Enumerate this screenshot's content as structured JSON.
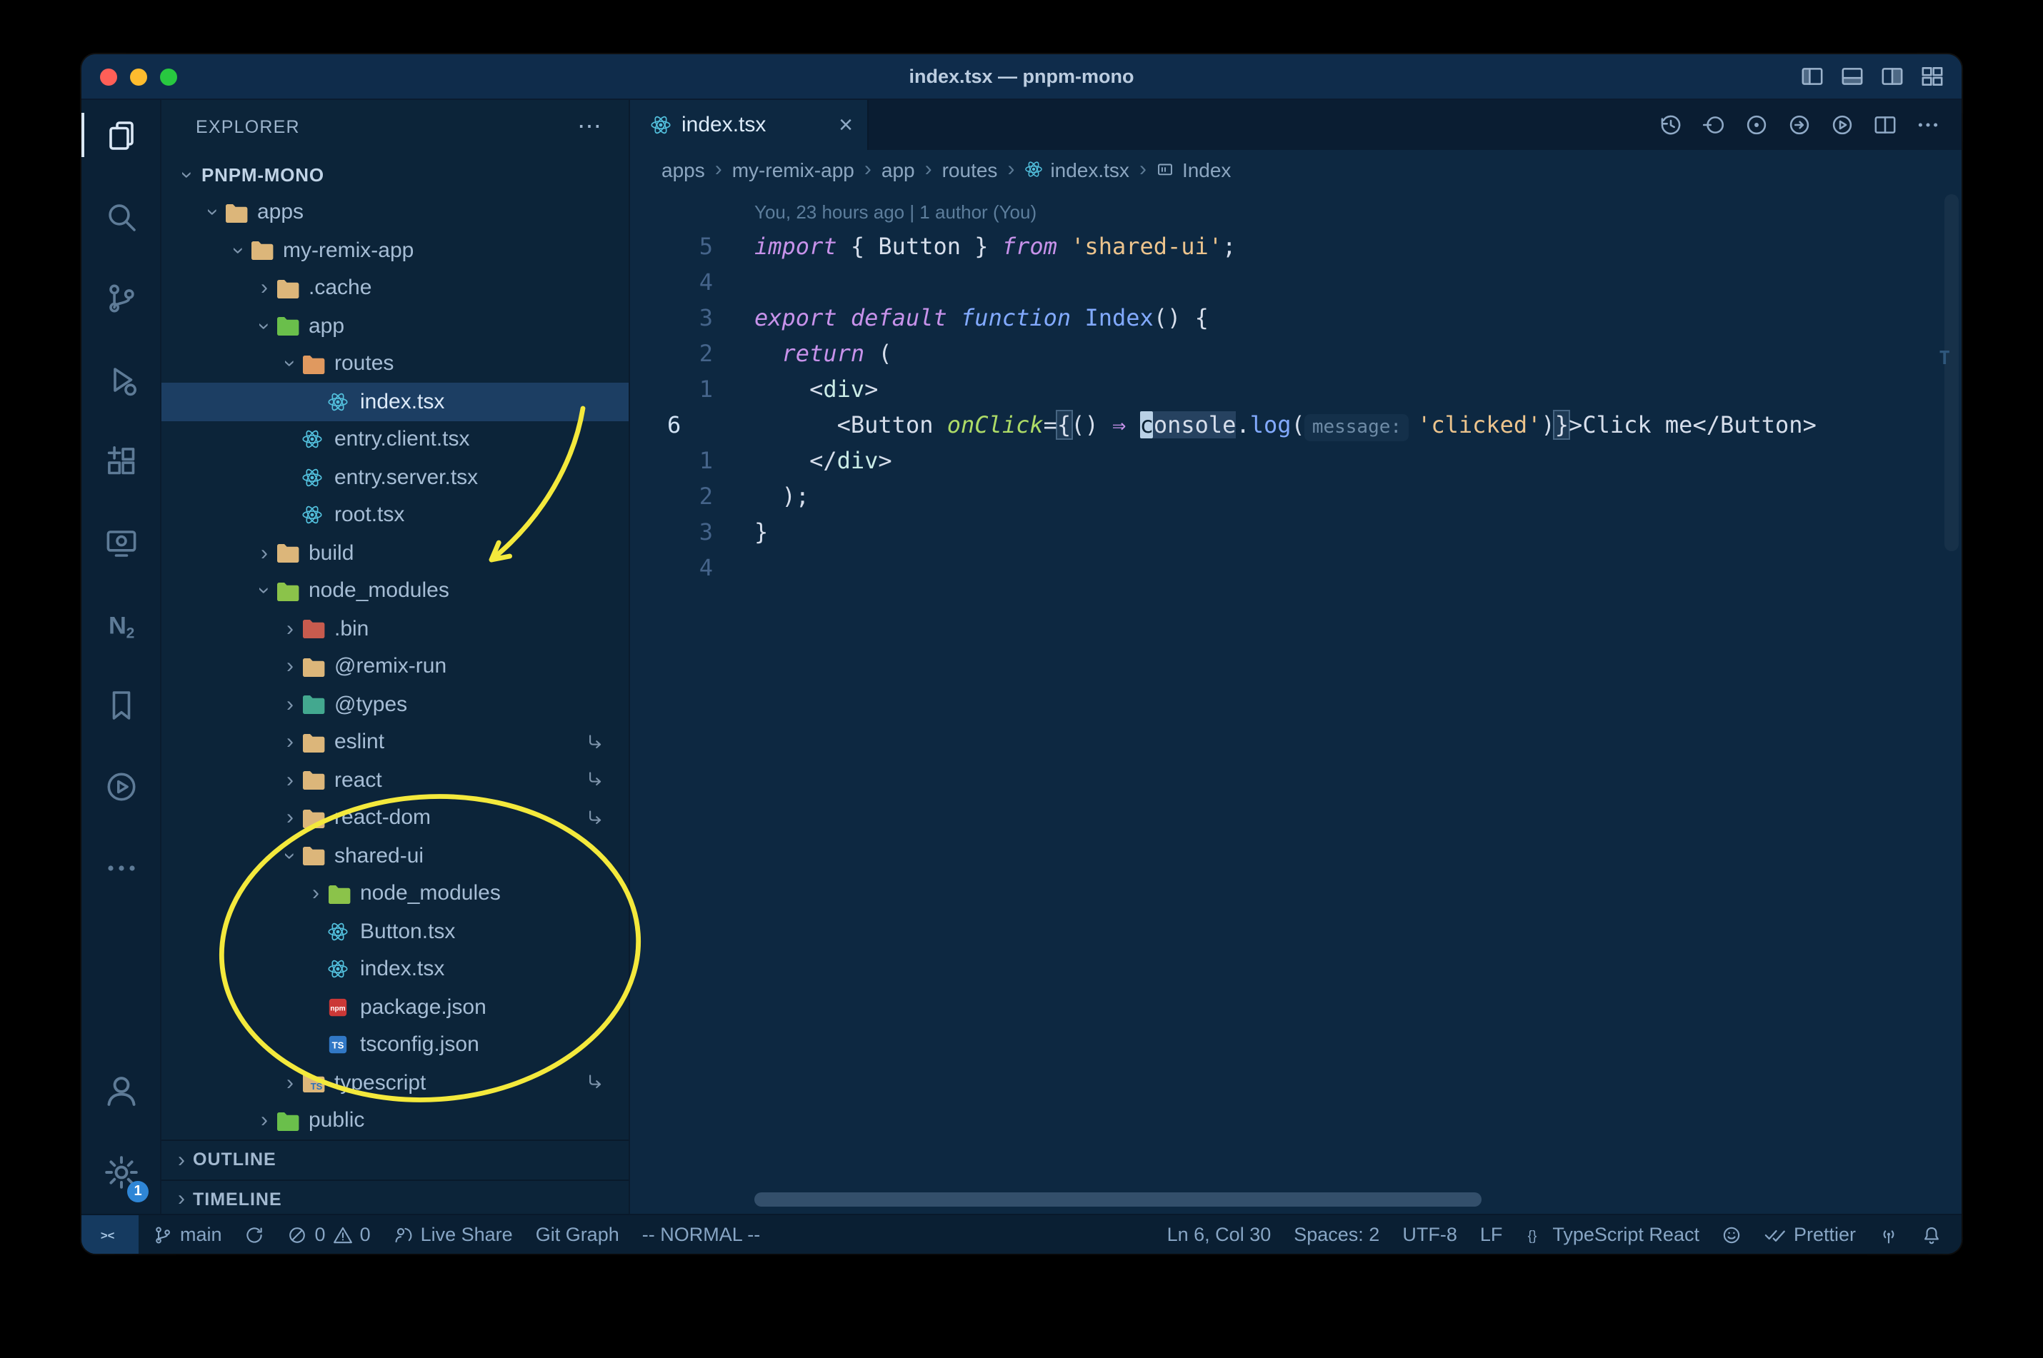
{
  "title_bar": {
    "title": "index.tsx — pnpm-mono",
    "layout_icons": [
      {
        "name": "toggle-sidebar",
        "icon": "layout-sidebar"
      },
      {
        "name": "toggle-panel",
        "icon": "layout-panel"
      },
      {
        "name": "split-editor-layout",
        "icon": "layout-split"
      },
      {
        "name": "customize-layout",
        "icon": "layout-grid"
      }
    ]
  },
  "activity_bar": {
    "top": [
      {
        "name": "explorer",
        "icon": "files",
        "active": true
      },
      {
        "name": "search",
        "icon": "search"
      },
      {
        "name": "source-control",
        "icon": "scm"
      },
      {
        "name": "run-and-debug",
        "icon": "debug"
      },
      {
        "name": "extensions",
        "icon": "extensions"
      },
      {
        "name": "remote-explorer",
        "icon": "remote"
      },
      {
        "name": "nx-console",
        "icon": "nx"
      },
      {
        "name": "bookmarks",
        "icon": "bookmark"
      },
      {
        "name": "code-runner",
        "icon": "play-circle"
      },
      {
        "name": "more-views",
        "icon": "ellipsis"
      }
    ],
    "bottom": [
      {
        "name": "accounts",
        "icon": "account"
      },
      {
        "name": "settings",
        "icon": "gear",
        "badge": "1"
      }
    ]
  },
  "explorer": {
    "header": "EXPLORER",
    "more": "⋯",
    "chevron_glyph": "›",
    "tree": [
      {
        "label": "PNPM-MONO",
        "depth": 0,
        "chevron": "down",
        "icon": "none",
        "root": true
      },
      {
        "label": "apps",
        "depth": 1,
        "chevron": "down",
        "icon": "folder",
        "color": "#dcb67a"
      },
      {
        "label": "my-remix-app",
        "depth": 2,
        "chevron": "down",
        "icon": "folder",
        "color": "#dcb67a"
      },
      {
        "label": ".cache",
        "depth": 3,
        "chevron": "right",
        "icon": "folder",
        "color": "#dcb67a"
      },
      {
        "label": "app",
        "depth": 3,
        "chevron": "down",
        "icon": "folder",
        "color": "#6abf4b"
      },
      {
        "label": "routes",
        "depth": 4,
        "chevron": "down",
        "icon": "folder",
        "color": "#e0995f"
      },
      {
        "label": "index.tsx",
        "depth": 5,
        "chevron": "none",
        "icon": "react",
        "selected": true
      },
      {
        "label": "entry.client.tsx",
        "depth": 4,
        "chevron": "none",
        "icon": "react"
      },
      {
        "label": "entry.server.tsx",
        "depth": 4,
        "chevron": "none",
        "icon": "react"
      },
      {
        "label": "root.tsx",
        "depth": 4,
        "chevron": "none",
        "icon": "react"
      },
      {
        "label": "build",
        "depth": 3,
        "chevron": "right",
        "icon": "folder",
        "color": "#dcb67a"
      },
      {
        "label": "node_modules",
        "depth": 3,
        "chevron": "down",
        "icon": "folder",
        "color": "#8bc34a"
      },
      {
        "label": ".bin",
        "depth": 4,
        "chevron": "right",
        "icon": "folder",
        "color": "#c75b4e"
      },
      {
        "label": "@remix-run",
        "depth": 4,
        "chevron": "right",
        "icon": "folder",
        "color": "#dcb67a"
      },
      {
        "label": "@types",
        "depth": 4,
        "chevron": "right",
        "icon": "folder",
        "color": "#43a88f"
      },
      {
        "label": "eslint",
        "depth": 4,
        "chevron": "right",
        "icon": "folder",
        "color": "#dcb67a",
        "symlink": true
      },
      {
        "label": "react",
        "depth": 4,
        "chevron": "right",
        "icon": "folder",
        "color": "#dcb67a",
        "symlink": true
      },
      {
        "label": "react-dom",
        "depth": 4,
        "chevron": "right",
        "icon": "folder",
        "color": "#dcb67a",
        "symlink": true
      },
      {
        "label": "shared-ui",
        "depth": 4,
        "chevron": "down",
        "icon": "folder",
        "color": "#dcb67a"
      },
      {
        "label": "node_modules",
        "depth": 5,
        "chevron": "right",
        "icon": "folder",
        "color": "#8bc34a"
      },
      {
        "label": "Button.tsx",
        "depth": 5,
        "chevron": "none",
        "icon": "react"
      },
      {
        "label": "index.tsx",
        "depth": 5,
        "chevron": "none",
        "icon": "react"
      },
      {
        "label": "package.json",
        "depth": 5,
        "chevron": "none",
        "icon": "npm"
      },
      {
        "label": "tsconfig.json",
        "depth": 5,
        "chevron": "none",
        "icon": "ts"
      },
      {
        "label": "typescript",
        "depth": 4,
        "chevron": "right",
        "icon": "folder-ts",
        "color": "#dcb67a",
        "symlink": true
      },
      {
        "label": "public",
        "depth": 3,
        "chevron": "right",
        "icon": "folder",
        "color": "#6abf4b"
      }
    ],
    "sections": [
      {
        "label": "OUTLINE"
      },
      {
        "label": "TIMELINE"
      }
    ]
  },
  "tab": {
    "label": "index.tsx",
    "close": "×"
  },
  "editor_actions": [
    {
      "name": "timeline-history",
      "icon": "history"
    },
    {
      "name": "gitlens-toggle-blame",
      "icon": "circle-left"
    },
    {
      "name": "gitlens-heatmap",
      "icon": "circle-dot"
    },
    {
      "name": "open-changes",
      "icon": "circle-arrow"
    },
    {
      "name": "run-code",
      "icon": "play-circle-sm"
    },
    {
      "name": "split-editor",
      "icon": "split"
    },
    {
      "name": "more-actions",
      "icon": "ellipsis-sm"
    }
  ],
  "breadcrumb_separator": "›",
  "breadcrumbs": [
    {
      "label": "apps"
    },
    {
      "label": "my-remix-app"
    },
    {
      "label": "app"
    },
    {
      "label": "routes"
    },
    {
      "label": "index.tsx",
      "icon": "react"
    },
    {
      "label": "Index",
      "icon": "symbol-module"
    }
  ],
  "editor": {
    "blame_annotation": "You, 23 hours ago | 1 author (You)",
    "overview_mark": "T",
    "lines": [
      {
        "num": "5",
        "segments": [
          {
            "t": "import",
            "c": "kw"
          },
          {
            "t": " { ",
            "c": "pun"
          },
          {
            "t": "Button",
            "c": "pun"
          },
          {
            "t": " } ",
            "c": "pun"
          },
          {
            "t": "from",
            "c": "kw"
          },
          {
            "t": " ",
            "c": "pun"
          },
          {
            "t": "'shared-ui'",
            "c": "str"
          },
          {
            "t": ";",
            "c": "pun"
          }
        ]
      },
      {
        "num": "4",
        "segments": []
      },
      {
        "num": "3",
        "segments": [
          {
            "t": "export",
            "c": "kw"
          },
          {
            "t": " ",
            "c": "pun"
          },
          {
            "t": "default",
            "c": "kw"
          },
          {
            "t": " ",
            "c": "pun"
          },
          {
            "t": "function",
            "c": "st"
          },
          {
            "t": " ",
            "c": "pun"
          },
          {
            "t": "Index",
            "c": "fn"
          },
          {
            "t": "() {",
            "c": "pun"
          }
        ]
      },
      {
        "num": "2",
        "segments": [
          {
            "t": "  ",
            "c": "pun"
          },
          {
            "t": "return",
            "c": "kw"
          },
          {
            "t": " (",
            "c": "pun"
          }
        ]
      },
      {
        "num": "1",
        "segments": [
          {
            "t": "    <",
            "c": "pun"
          },
          {
            "t": "div",
            "c": "tag"
          },
          {
            "t": ">",
            "c": "pun"
          }
        ]
      },
      {
        "num": "6",
        "current": true,
        "segments": [
          {
            "t": "      <",
            "c": "pun"
          },
          {
            "t": "Button",
            "c": "comp"
          },
          {
            "t": " ",
            "c": "pun"
          },
          {
            "t": "onClick",
            "c": "attr"
          },
          {
            "t": "=",
            "c": "pun"
          },
          {
            "t": "{",
            "c": "brk"
          },
          {
            "t": "() ",
            "c": "pun"
          },
          {
            "t": "⇒",
            "c": "arrow"
          },
          {
            "t": " ",
            "c": "pun"
          },
          {
            "t": "c",
            "c": "cursor"
          },
          {
            "t": "onsole",
            "c": "occ"
          },
          {
            "t": ".",
            "c": "pun"
          },
          {
            "t": "log",
            "c": "fn"
          },
          {
            "t": "(",
            "c": "pun"
          },
          {
            "t": "message:",
            "c": "inlay"
          },
          {
            "t": "'clicked'",
            "c": "str"
          },
          {
            "t": ")",
            "c": "pun"
          },
          {
            "t": "}",
            "c": "brk"
          },
          {
            "t": ">",
            "c": "pun"
          },
          {
            "t": "Click me",
            "c": "txt"
          },
          {
            "t": "</",
            "c": "pun"
          },
          {
            "t": "Button",
            "c": "comp"
          },
          {
            "t": ">",
            "c": "pun"
          }
        ]
      },
      {
        "num": "1",
        "segments": [
          {
            "t": "    </",
            "c": "pun"
          },
          {
            "t": "div",
            "c": "tag"
          },
          {
            "t": ">",
            "c": "pun"
          }
        ]
      },
      {
        "num": "2",
        "segments": [
          {
            "t": "  );",
            "c": "pun"
          }
        ]
      },
      {
        "num": "3",
        "segments": [
          {
            "t": "}",
            "c": "pun"
          }
        ]
      },
      {
        "num": "4",
        "segments": []
      }
    ]
  },
  "status_bar": {
    "left": [
      {
        "name": "remote-indicator",
        "style": "remote",
        "parts": [
          {
            "icon": "remote-brackets"
          }
        ]
      },
      {
        "name": "git-branch",
        "parts": [
          {
            "icon": "branch"
          },
          {
            "text": "main"
          }
        ]
      },
      {
        "name": "git-sync",
        "parts": [
          {
            "icon": "sync"
          }
        ]
      },
      {
        "name": "problems",
        "parts": [
          {
            "icon": "error"
          },
          {
            "text": "0"
          },
          {
            "icon": "warning"
          },
          {
            "text": "0"
          }
        ]
      },
      {
        "name": "live-share",
        "parts": [
          {
            "icon": "liveshare"
          },
          {
            "text": "Live Share"
          }
        ]
      },
      {
        "name": "git-graph",
        "parts": [
          {
            "text": "Git Graph"
          }
        ]
      },
      {
        "name": "vim-mode",
        "parts": [
          {
            "text": "-- NORMAL --"
          }
        ]
      }
    ],
    "right": [
      {
        "name": "cursor-position",
        "parts": [
          {
            "text": "Ln 6, Col 30"
          }
        ]
      },
      {
        "name": "indentation",
        "parts": [
          {
            "text": "Spaces: 2"
          }
        ]
      },
      {
        "name": "encoding",
        "parts": [
          {
            "text": "UTF-8"
          }
        ]
      },
      {
        "name": "eol",
        "parts": [
          {
            "text": "LF"
          }
        ]
      },
      {
        "name": "language-mode",
        "parts": [
          {
            "icon": "braces"
          },
          {
            "text": "TypeScript React"
          }
        ]
      },
      {
        "name": "feedback",
        "parts": [
          {
            "icon": "smiley"
          }
        ]
      },
      {
        "name": "prettier",
        "parts": [
          {
            "icon": "check-all"
          },
          {
            "text": "Prettier"
          }
        ]
      },
      {
        "name": "tunnel",
        "parts": [
          {
            "icon": "broadcast"
          }
        ]
      },
      {
        "name": "notifications",
        "parts": [
          {
            "icon": "bell"
          }
        ]
      }
    ]
  },
  "annotations": {
    "color": "#f4e93c"
  }
}
